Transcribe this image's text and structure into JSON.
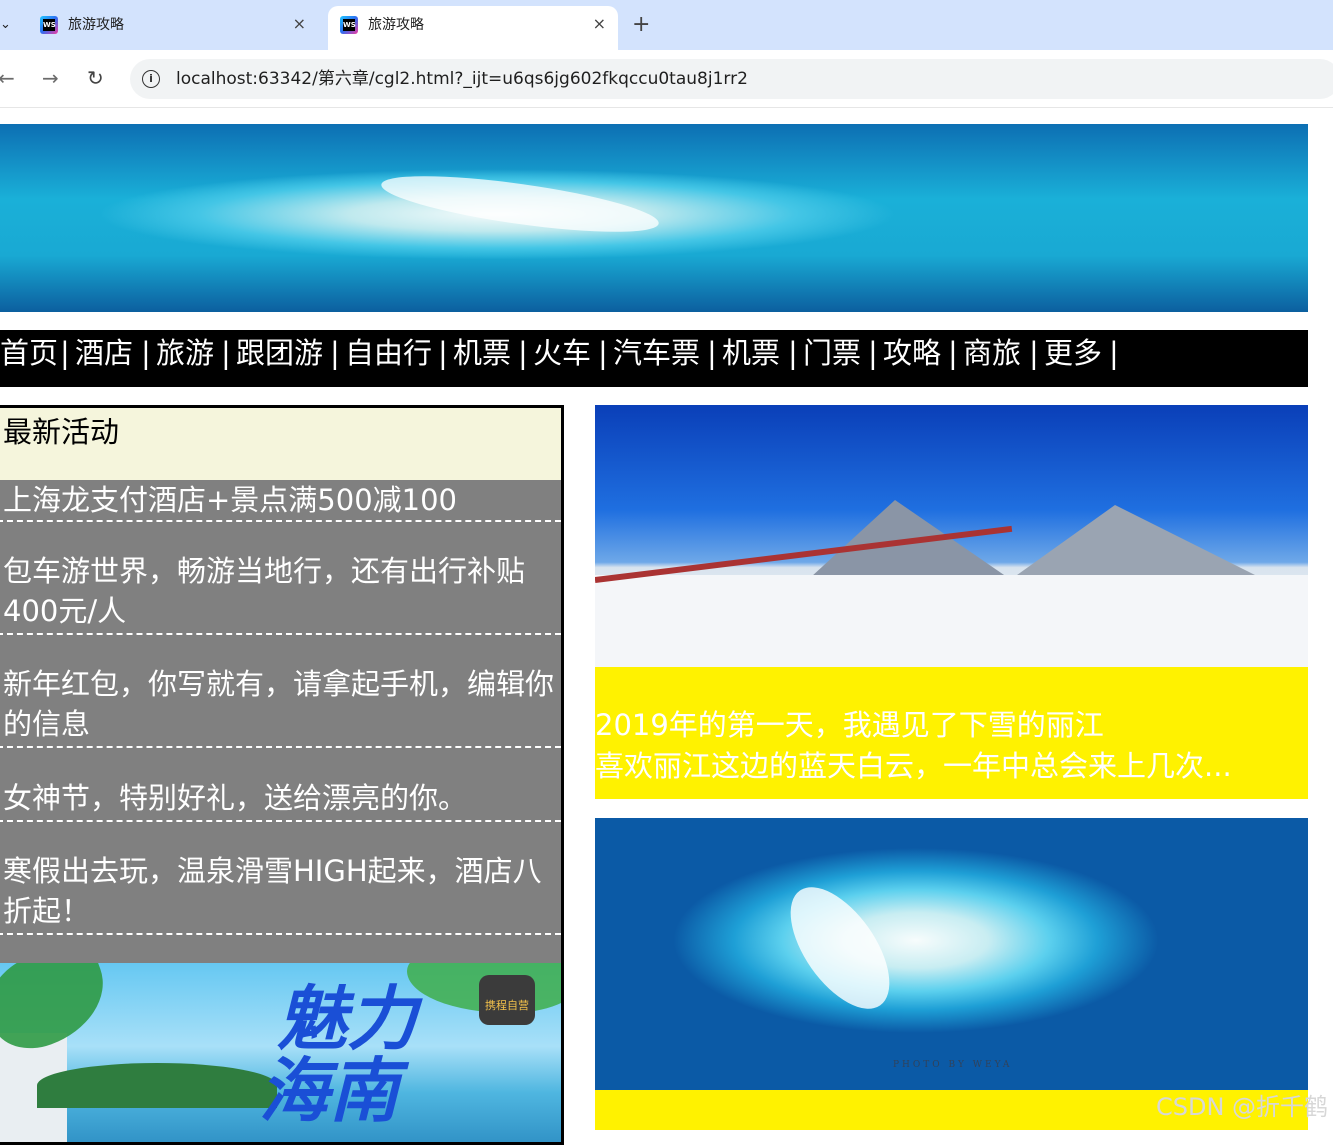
{
  "browser": {
    "tabs": [
      {
        "title": "旅游攻略",
        "close": "×",
        "active": false
      },
      {
        "title": "旅游攻略",
        "close": "×",
        "active": true
      }
    ],
    "favicon_text": "WS",
    "new_tab": "+",
    "tab_menu": "⌄",
    "back": "←",
    "forward": "→",
    "reload": "↻",
    "info": "i",
    "url": "localhost:63342/第六章/cgl2.html?_ijt=u6qs6jg602fkqccu0tau8j1rr2"
  },
  "nav": {
    "items": [
      "首页",
      "酒店",
      "旅游",
      "跟团游",
      "自由行",
      "机票",
      "火车",
      "汽车票",
      "机票",
      "门票",
      "攻略",
      "商旅",
      "更多"
    ],
    "separator": "|"
  },
  "activities": {
    "title": "最新活动",
    "items": [
      "上海龙支付酒店+景点满500减100",
      "包车游世界，畅游当地行，还有出行补贴400元/人",
      "新年红包，你写就有，请拿起手机，编辑你的信息",
      "女神节，特别好礼，送给漂亮的你。",
      "寒假出去玩，温泉滑雪HIGH起来，酒店八折起！"
    ]
  },
  "promo": {
    "headline_1": "魅力",
    "headline_2": "海南",
    "brand": "携程自营"
  },
  "card1": {
    "line1": "2019年的第一天，我遇见了下雪的丽江",
    "line2": "喜欢丽江这边的蓝天白云，一年中总会来上几次..."
  },
  "card2": {
    "photo_credit": "PHOTO BY WEYA"
  },
  "watermark": "CSDN @折千鹤",
  "colors": {
    "nav_bg": "#000000",
    "activity_bg": "#808080",
    "activity_head_bg": "#f5f5dc",
    "card_bg": "#fff200"
  }
}
